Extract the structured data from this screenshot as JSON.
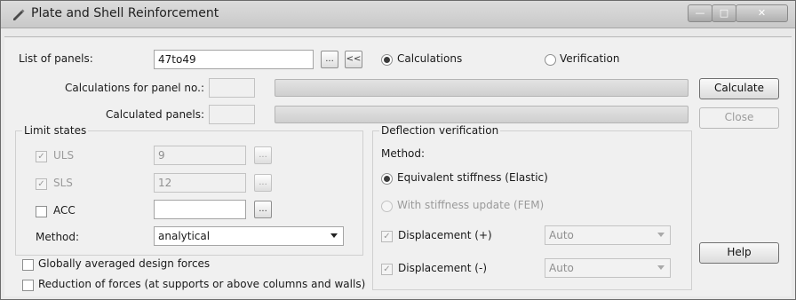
{
  "window": {
    "title": "Plate and Shell Reinforcement",
    "minimize_icon": "minimize-icon",
    "maximize_icon": "maximize-icon",
    "close_icon": "close-icon",
    "minimize_glyph": "—",
    "maximize_glyph": "□",
    "close_glyph": "✕"
  },
  "panels": {
    "label": "List of panels:",
    "value": "47to49",
    "browse_label": "...",
    "select_label": "<<"
  },
  "mode": {
    "calculations": "Calculations",
    "verification": "Verification"
  },
  "progress": {
    "calc_for_panel_label": "Calculations for panel no.:",
    "calculated_panels_label": "Calculated panels:"
  },
  "buttons": {
    "calculate": "Calculate",
    "close": "Close",
    "help": "Help"
  },
  "limit_states": {
    "title": "Limit states",
    "uls_label": "ULS",
    "uls_value": "9",
    "sls_label": "SLS",
    "sls_value": "12",
    "acc_label": "ACC",
    "acc_value": "",
    "dots": "...",
    "check": "✓",
    "method_label": "Method:",
    "method_value": "analytical"
  },
  "options": {
    "globally_averaged": "Globally averaged design forces",
    "reduction": "Reduction of forces (at supports or above columns and walls)"
  },
  "deflection": {
    "title": "Deflection verification",
    "method_label": "Method:",
    "equivalent": "Equivalent stiffness (Elastic)",
    "with_update": "With stiffness update (FEM)",
    "disp_plus": "Displacement (+)",
    "disp_minus": "Displacement (-)",
    "auto_plus": "Auto",
    "auto_minus": "Auto",
    "check": "✓"
  }
}
